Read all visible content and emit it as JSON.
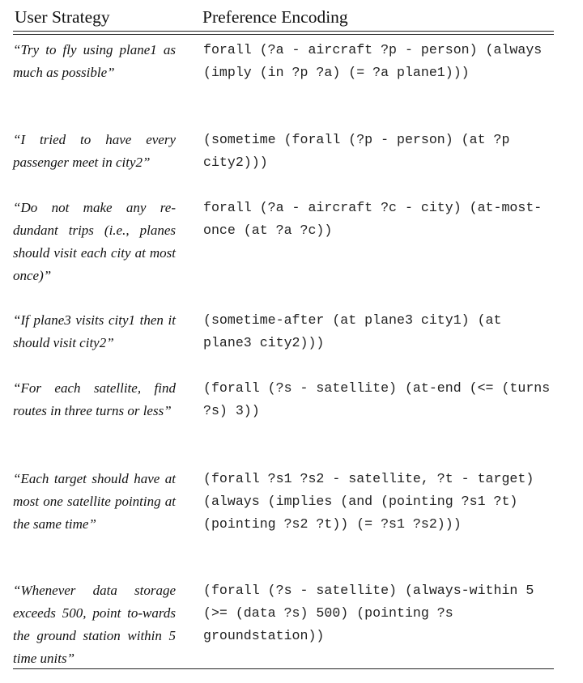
{
  "headers": {
    "strategy": "User Strategy",
    "encoding": "Preference Encoding"
  },
  "rows": [
    {
      "strategy": "“Try to fly using plane1 as much as possible”",
      "encoding": "forall (?a - aircraft ?p - person) (always (imply (in ?p ?a) (= ?a plane1)))"
    },
    {
      "strategy": "“I tried to have every passenger meet in city2”",
      "encoding": "(sometime (forall (?p - person) (at ?p city2)))"
    },
    {
      "strategy": "“Do not make any re-dundant trips (i.e., planes should visit each city at most once)”",
      "encoding": "forall (?a - aircraft ?c - city) (at-most-once (at ?a ?c))"
    },
    {
      "strategy": "“If plane3 visits city1 then it should visit city2”",
      "encoding": "(sometime-after (at plane3 city1) (at plane3 city2)))"
    },
    {
      "strategy": "“For each satellite, find routes in three turns or less”",
      "encoding": "(forall (?s - satellite) (at-end (<= (turns ?s) 3))"
    },
    {
      "strategy": "“Each target should have at most one satellite pointing at the same time”",
      "encoding": "(forall ?s1 ?s2 - satellite, ?t - target) (always (implies (and (pointing ?s1 ?t) (pointing ?s2 ?t)) (= ?s1 ?s2)))"
    },
    {
      "strategy": "“Whenever data storage exceeds 500, point to-wards the ground station within 5 time units”",
      "encoding": "(forall (?s - satellite) (always-within 5 (>= (data ?s) 500) (pointing ?s groundstation))"
    }
  ]
}
